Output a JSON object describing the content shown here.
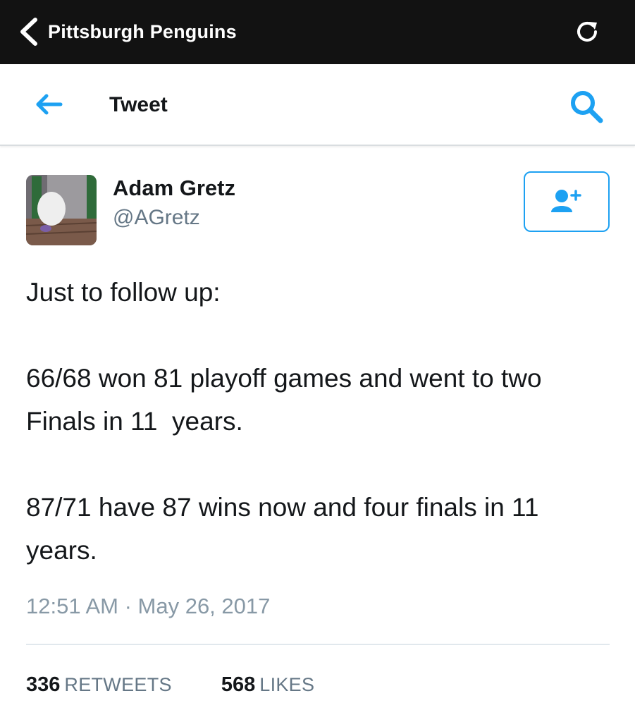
{
  "topbar": {
    "title": "Pittsburgh Penguins",
    "back_icon": "chevron-left-icon",
    "reload_icon": "reload-icon"
  },
  "navbar": {
    "title": "Tweet",
    "back_icon": "arrow-left-icon",
    "search_icon": "search-icon"
  },
  "tweet": {
    "author_name": "Adam Gretz",
    "author_handle": "@AGretz",
    "follow_icon": "add-user-icon",
    "text": {
      "line1": "Just to follow up:",
      "para2": "66/68 won 81 playoff games and went to two Finals in 11  years.",
      "para3": "87/71 have 87 wins now and four finals in 11 years."
    },
    "timestamp": "12:51 AM · May 26, 2017",
    "retweets": {
      "count": "336",
      "label": "RETWEETS"
    },
    "likes": {
      "count": "568",
      "label": "LIKES"
    }
  },
  "colors": {
    "accent": "#1da1f2",
    "topbar_bg": "#121212",
    "secondary_text": "#657786",
    "timestamp_text": "#8899a6"
  }
}
